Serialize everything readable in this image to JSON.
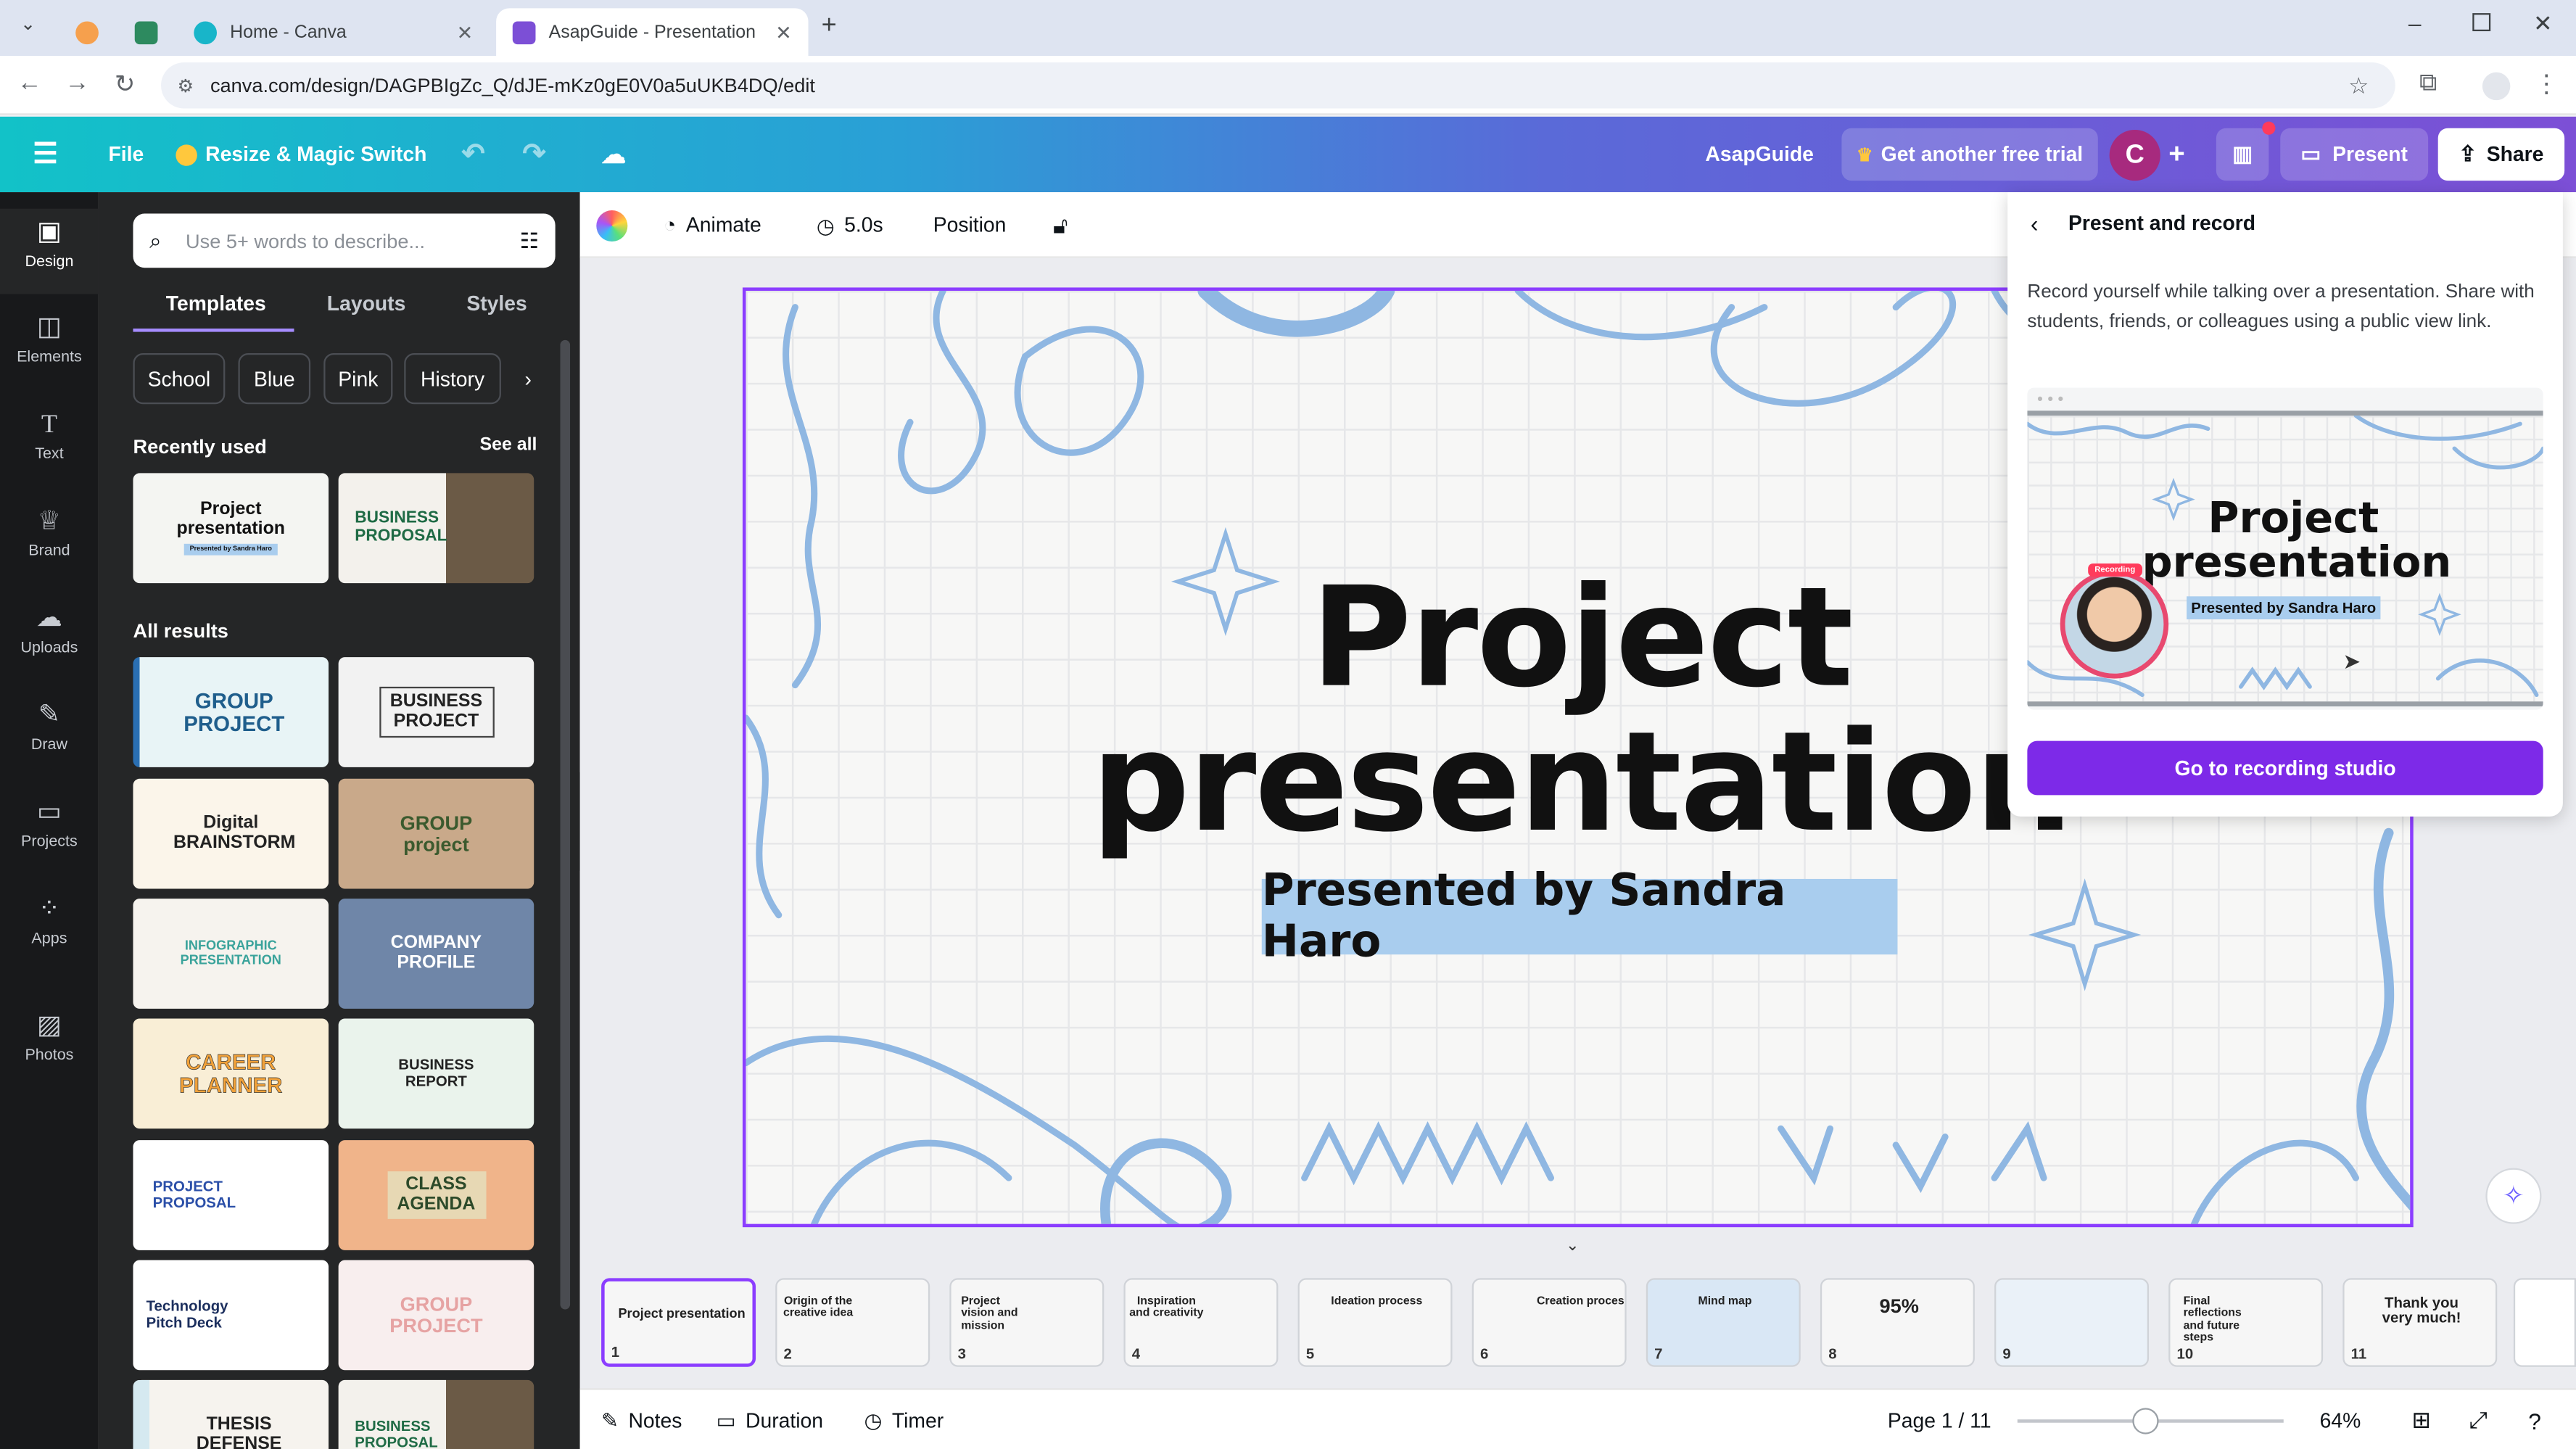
{
  "browser": {
    "tabs": [
      {
        "label": ""
      },
      {
        "label": ""
      },
      {
        "label": "Home - Canva"
      },
      {
        "label": "AsapGuide - Presentation"
      }
    ],
    "url": "canva.com/design/DAGPBIgZc_Q/dJE-mKz0gE0V0a5uUKB4DQ/edit"
  },
  "header": {
    "file": "File",
    "resize": "Resize & Magic Switch",
    "team": "AsapGuide",
    "trial": "Get another free trial",
    "avatar_letter": "C",
    "present": "Present",
    "share": "Share"
  },
  "rail": [
    {
      "label": "Design",
      "icon": "design-icon"
    },
    {
      "label": "Elements",
      "icon": "elements-icon"
    },
    {
      "label": "Text",
      "icon": "text-icon"
    },
    {
      "label": "Brand",
      "icon": "brand-icon"
    },
    {
      "label": "Uploads",
      "icon": "uploads-icon"
    },
    {
      "label": "Draw",
      "icon": "draw-icon"
    },
    {
      "label": "Projects",
      "icon": "projects-icon"
    },
    {
      "label": "Apps",
      "icon": "apps-icon"
    },
    {
      "label": "Photos",
      "icon": "photos-icon"
    }
  ],
  "panel": {
    "search_placeholder": "Use 5+ words to describe...",
    "tabs": [
      "Templates",
      "Layouts",
      "Styles"
    ],
    "chips": [
      "School",
      "Blue",
      "Pink",
      "History"
    ],
    "recently_used": "Recently used",
    "see_all": "See all",
    "all_results": "All results",
    "recent": [
      {
        "text": "Project presentation",
        "sub": "Presented by Sandra Haro"
      },
      {
        "text": "BUSINESS PROPOSAL",
        "sub": ""
      }
    ],
    "results": [
      {
        "text": "GROUP PROJECT"
      },
      {
        "text": "BUSINESS PROJECT"
      },
      {
        "text": "Digital BRAINSTORM"
      },
      {
        "text": "GROUP project"
      },
      {
        "text": "INFOGRAPHIC PRESENTATION"
      },
      {
        "text": "COMPANY PROFILE"
      },
      {
        "text": "CAREER PLANNER"
      },
      {
        "text": "BUSINESS REPORT"
      },
      {
        "text": "PROJECT PROPOSAL"
      },
      {
        "text": "CLASS AGENDA"
      },
      {
        "text": "Technology Pitch Deck"
      },
      {
        "text": "GROUP PROJECT"
      },
      {
        "text": "THESIS DEFENSE"
      },
      {
        "text": "BUSINESS PROPOSAL"
      }
    ]
  },
  "toolbar": {
    "animate": "Animate",
    "duration": "5.0s",
    "position": "Position"
  },
  "slide": {
    "title_line1": "Project",
    "title_line2": "presentation",
    "subtitle": "Presented by Sandra Haro"
  },
  "popup": {
    "title": "Present and record",
    "description": "Record yourself while talking over a presentation. Share with students, friends, or colleagues using a public view link.",
    "preview_title_1": "Project",
    "preview_title_2": "presentation",
    "preview_sub": "Presented by Sandra Haro",
    "recording_badge": "Recording",
    "cta": "Go to recording studio"
  },
  "filmstrip": [
    {
      "n": "1",
      "t": "Project presentation"
    },
    {
      "n": "2",
      "t": "Origin of the creative idea"
    },
    {
      "n": "3",
      "t": "Project vision and mission"
    },
    {
      "n": "4",
      "t": "Inspiration and creativity"
    },
    {
      "n": "5",
      "t": "Ideation process"
    },
    {
      "n": "6",
      "t": "Creation process"
    },
    {
      "n": "7",
      "t": "Mind map"
    },
    {
      "n": "8",
      "t": "95%"
    },
    {
      "n": "9",
      "t": ""
    },
    {
      "n": "10",
      "t": "Final reflections and future steps"
    },
    {
      "n": "11",
      "t": "Thank you very much!"
    }
  ],
  "bottombar": {
    "notes": "Notes",
    "duration": "Duration",
    "timer": "Timer",
    "page": "Page 1 / 11",
    "zoom": "64%",
    "zoom_level_percent": 64
  },
  "colors": {
    "accent": "#8b3dff",
    "header_start": "#12c2c8",
    "header_end": "#7c4fd6",
    "slide_highlight": "#a9cdee",
    "doodle": "#8fb7e2"
  }
}
